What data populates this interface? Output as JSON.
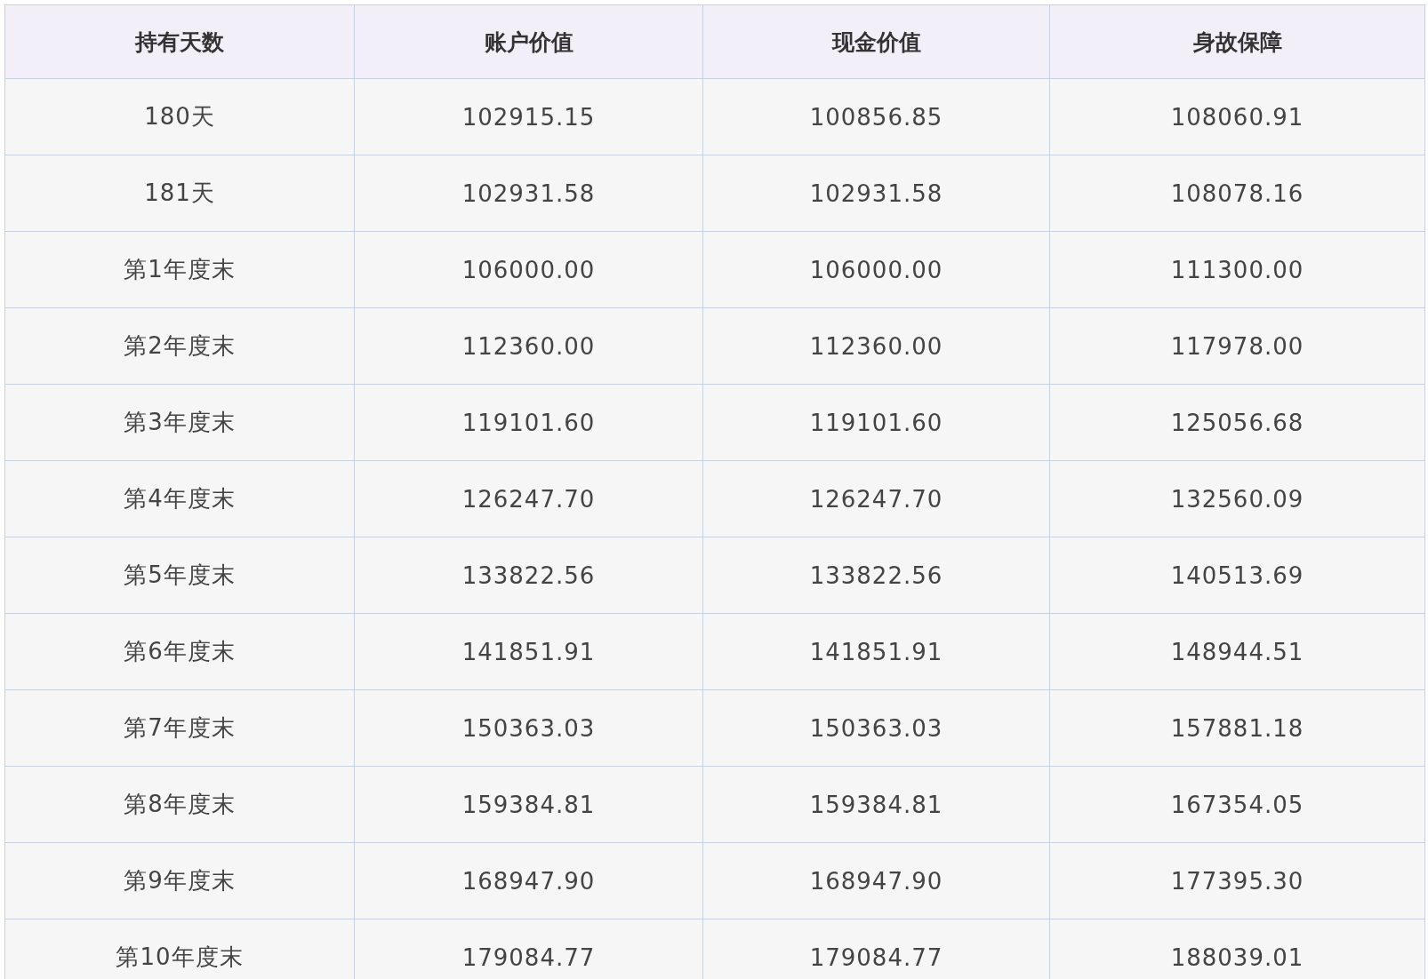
{
  "table": {
    "columns": [
      "持有天数",
      "账户价值",
      "现金价值",
      "身故保障"
    ],
    "rows": [
      [
        "180天",
        "102915.15",
        "100856.85",
        "108060.91"
      ],
      [
        "181天",
        "102931.58",
        "102931.58",
        "108078.16"
      ],
      [
        "第1年度末",
        "106000.00",
        "106000.00",
        "111300.00"
      ],
      [
        "第2年度末",
        "112360.00",
        "112360.00",
        "117978.00"
      ],
      [
        "第3年度末",
        "119101.60",
        "119101.60",
        "125056.68"
      ],
      [
        "第4年度末",
        "126247.70",
        "126247.70",
        "132560.09"
      ],
      [
        "第5年度末",
        "133822.56",
        "133822.56",
        "140513.69"
      ],
      [
        "第6年度末",
        "141851.91",
        "141851.91",
        "148944.51"
      ],
      [
        "第7年度末",
        "150363.03",
        "150363.03",
        "157881.18"
      ],
      [
        "第8年度末",
        "159384.81",
        "159384.81",
        "167354.05"
      ],
      [
        "第9年度末",
        "168947.90",
        "168947.90",
        "177395.30"
      ],
      [
        "第10年度末",
        "179084.77",
        "179084.77",
        "188039.01"
      ]
    ]
  }
}
